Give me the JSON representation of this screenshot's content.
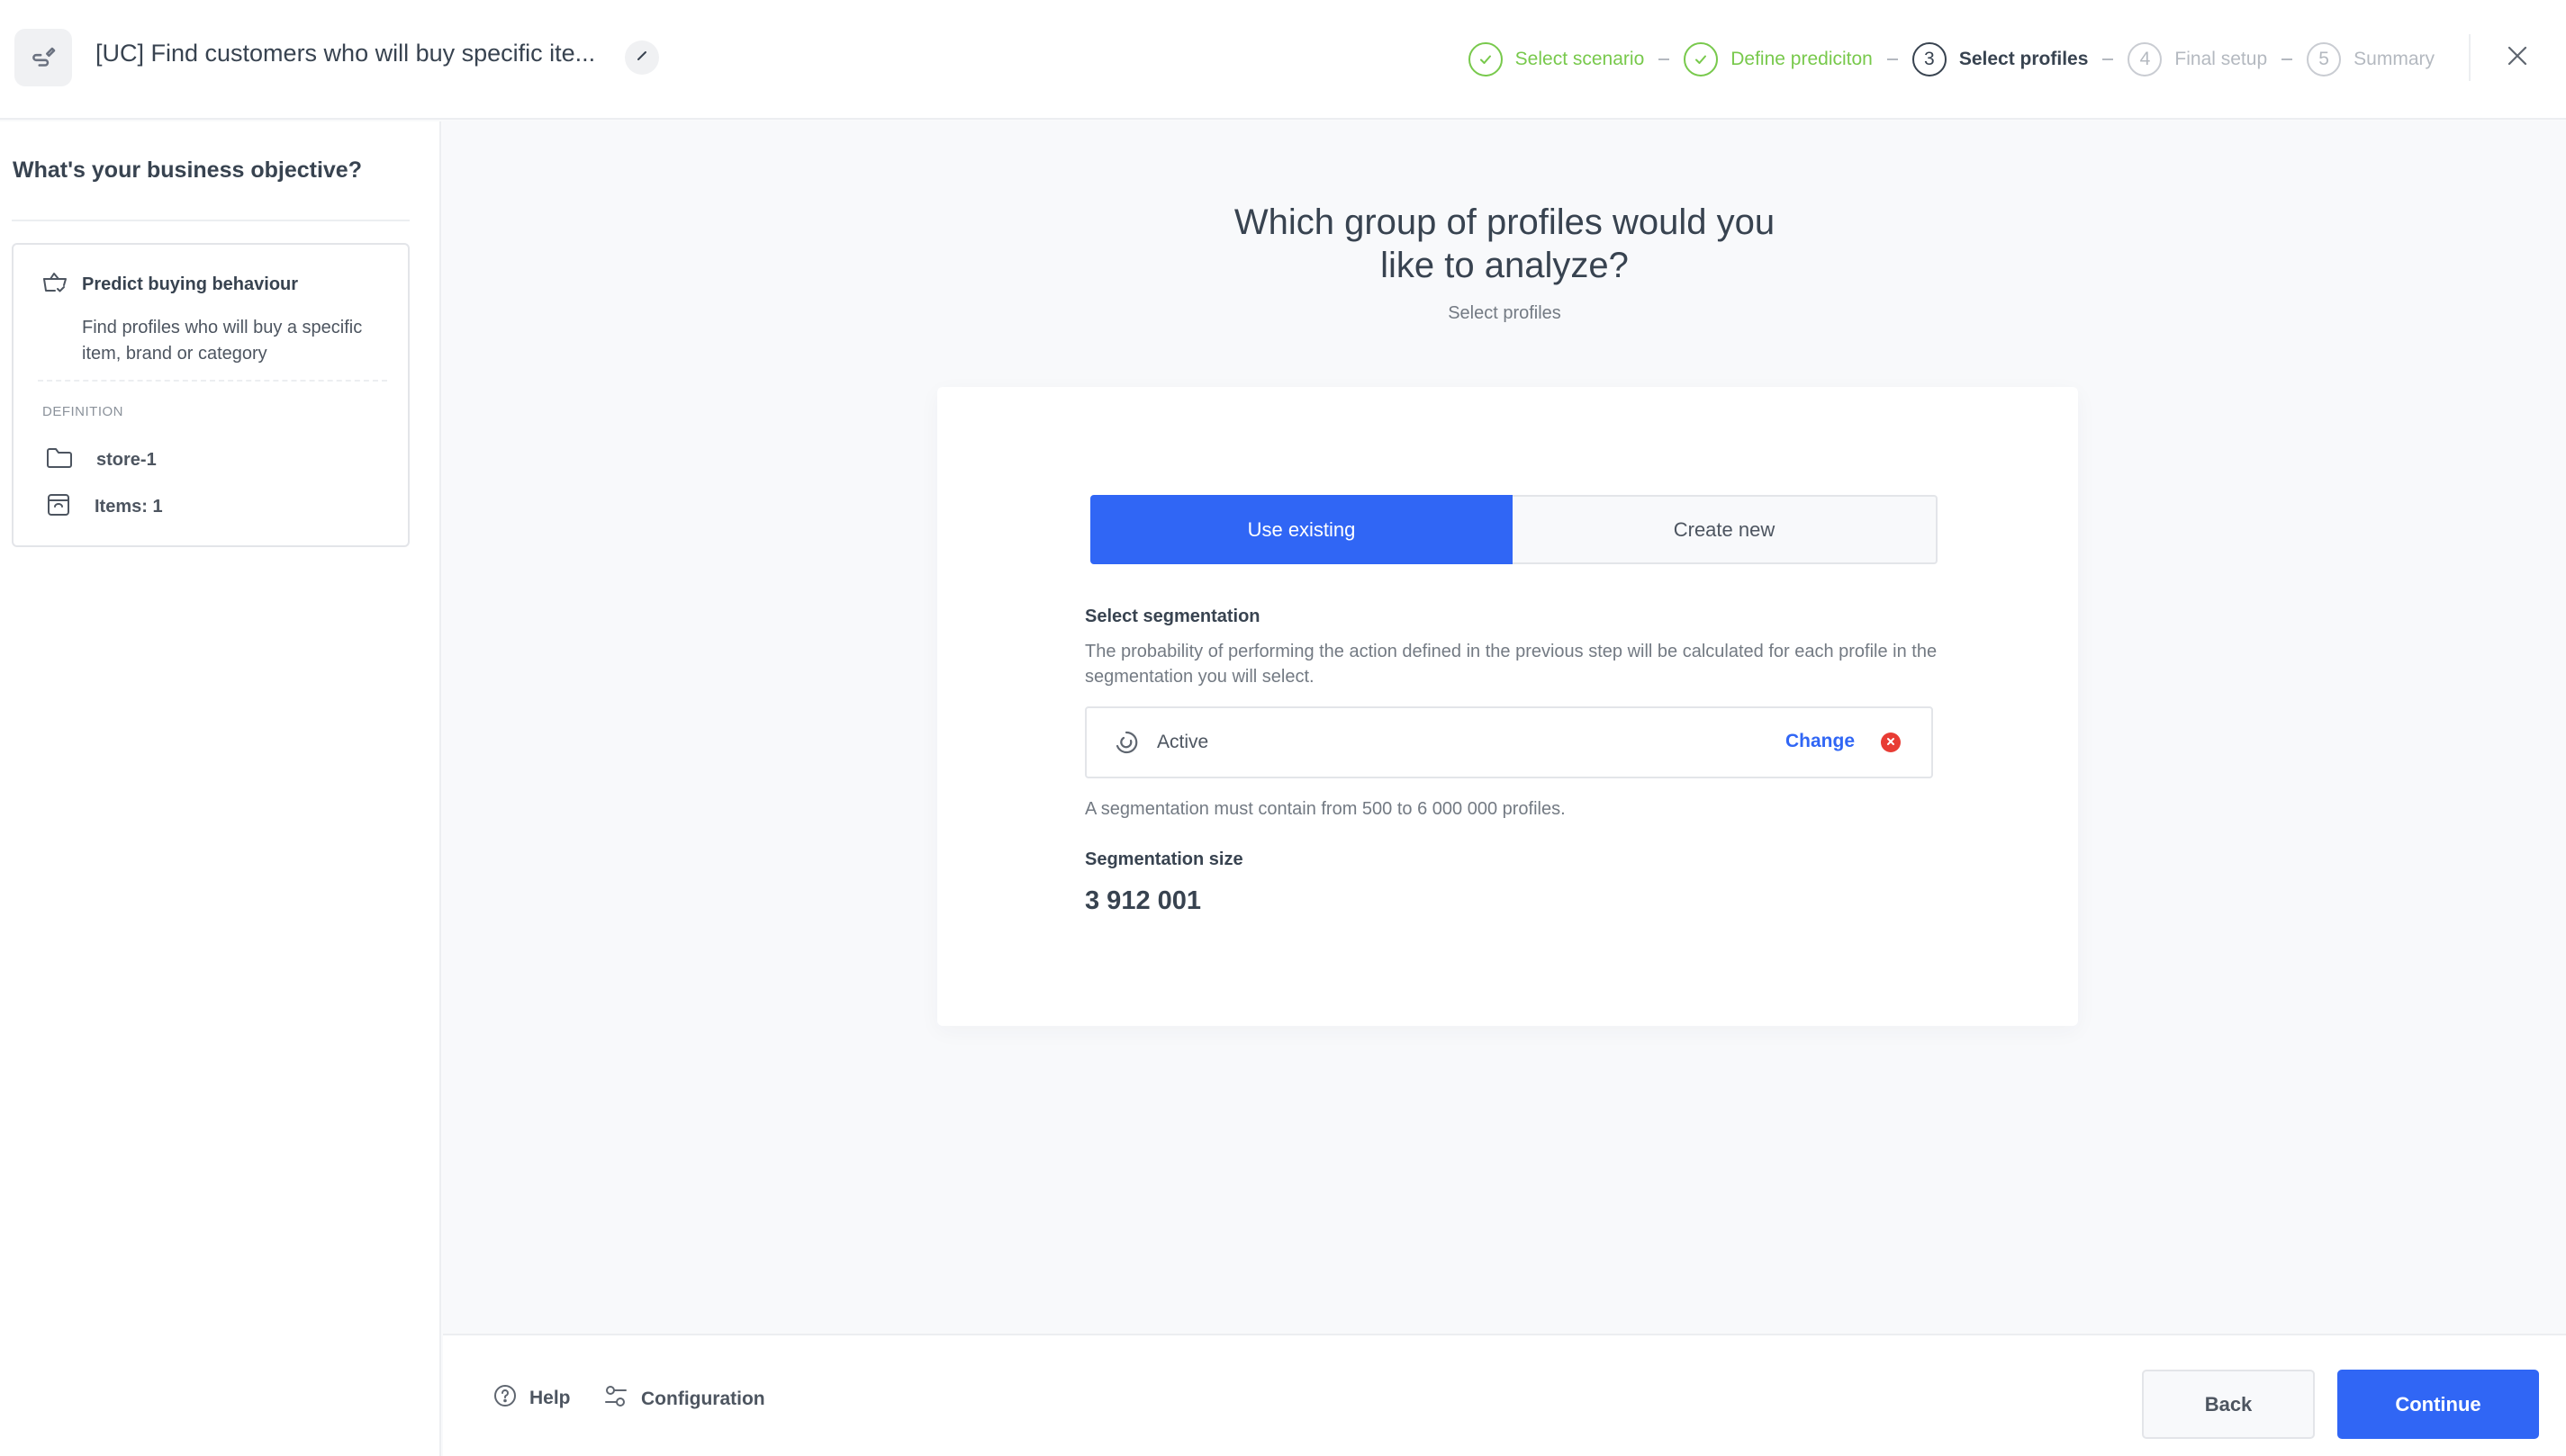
{
  "header": {
    "app_icon": "pencil-path-icon",
    "title": "[UC] Find customers who will buy specific ite...",
    "edit_icon": "pencil-icon",
    "close_icon": "close-icon",
    "steps": [
      {
        "number": "1",
        "label": "Select scenario",
        "state": "done"
      },
      {
        "number": "2",
        "label": "Define prediciton",
        "state": "done"
      },
      {
        "number": "3",
        "label": "Select profiles",
        "state": "current"
      },
      {
        "number": "4",
        "label": "Final setup",
        "state": "todo"
      },
      {
        "number": "5",
        "label": "Summary",
        "state": "todo"
      }
    ]
  },
  "sidebar": {
    "title": "What's your business objective?",
    "objective": {
      "icon": "basket-check-icon",
      "name": "Predict buying behaviour",
      "description": "Find profiles who will buy a specific item, brand or category"
    },
    "definition_label": "DEFINITION",
    "definition": [
      {
        "icon": "folder-icon",
        "text": "store-1"
      },
      {
        "icon": "item-box-icon",
        "text": "Items: 1"
      }
    ]
  },
  "main": {
    "headline_line1": "Which group of profiles would you",
    "headline_line2": "like to analyze?",
    "subheadline": "Select profiles",
    "toggle": {
      "use_existing": "Use existing",
      "create_new": "Create new",
      "selected": "use_existing"
    },
    "segmentation": {
      "label": "Select segmentation",
      "description": "The probability of performing the action defined in the previous step will be calculated for each profile in the segmentation you will select.",
      "selected_name": "Active",
      "change_label": "Change",
      "hint": "A segmentation must contain from 500 to 6 000 000 profiles.",
      "size_label": "Segmentation size",
      "size_value": "3 912 001"
    }
  },
  "footer": {
    "help_label": "Help",
    "configuration_label": "Configuration",
    "back_label": "Back",
    "continue_label": "Continue"
  },
  "colors": {
    "primary": "#3066f5",
    "success": "#78c94c",
    "danger": "#e83c34",
    "text": "#384350"
  }
}
